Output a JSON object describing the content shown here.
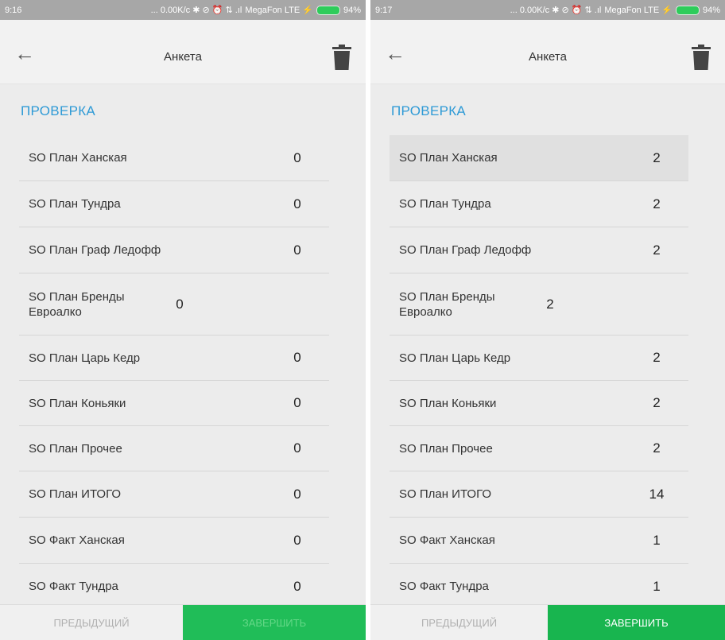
{
  "screens": [
    {
      "status": {
        "time": "9:16",
        "indicators": "... 0.00K/c ✱ ⊘ ⏰ ⇅ .ıl",
        "carrier": "MegaFon LTE ⚡",
        "battery": "94%"
      },
      "header": {
        "title": "Анкета",
        "back_icon": "arrow-left-icon",
        "delete_icon": "trash-icon"
      },
      "section_title": "ПРОВЕРКА",
      "rows": [
        {
          "label": "SO План Ханская",
          "value": "0"
        },
        {
          "label": "SO План Тундра",
          "value": "0"
        },
        {
          "label": "SO План Граф Ледофф",
          "value": "0"
        },
        {
          "label": "SO План Бренды Евроалко",
          "value": "0"
        },
        {
          "label": "SO План Царь Кедр",
          "value": "0"
        },
        {
          "label": "SO План Коньяки",
          "value": "0"
        },
        {
          "label": "SO План Прочее",
          "value": "0"
        },
        {
          "label": "SO План ИТОГО",
          "value": "0"
        },
        {
          "label": "SO Факт Ханская",
          "value": "0"
        },
        {
          "label": "SO Факт Тундра",
          "value": "0"
        }
      ],
      "buttons": {
        "prev": "ПРЕДЫДУЩИЙ",
        "finish": "ЗАВЕРШИТЬ"
      }
    },
    {
      "status": {
        "time": "9:17",
        "indicators": "... 0.00K/c ✱ ⊘ ⏰ ⇅ .ıl",
        "carrier": "MegaFon LTE ⚡",
        "battery": "94%"
      },
      "header": {
        "title": "Анкета",
        "back_icon": "arrow-left-icon",
        "delete_icon": "trash-icon"
      },
      "section_title": "ПРОВЕРКА",
      "rows": [
        {
          "label": "SO План Ханская",
          "value": "2"
        },
        {
          "label": "SO План Тундра",
          "value": "2"
        },
        {
          "label": "SO План Граф Ледофф",
          "value": "2"
        },
        {
          "label": "SO План Бренды Евроалко",
          "value": "2"
        },
        {
          "label": "SO План Царь Кедр",
          "value": "2"
        },
        {
          "label": "SO План Коньяки",
          "value": "2"
        },
        {
          "label": "SO План Прочее",
          "value": "2"
        },
        {
          "label": "SO План ИТОГО",
          "value": "14"
        },
        {
          "label": "SO Факт Ханская",
          "value": "1"
        },
        {
          "label": "SO Факт Тундра",
          "value": "1"
        }
      ],
      "buttons": {
        "prev": "ПРЕДЫДУЩИЙ",
        "finish": "ЗАВЕРШИТЬ"
      }
    }
  ],
  "colors": {
    "accent": "#2e9ad6",
    "finish_button": "#18b54f",
    "status_bar": "#a7a7a7"
  }
}
